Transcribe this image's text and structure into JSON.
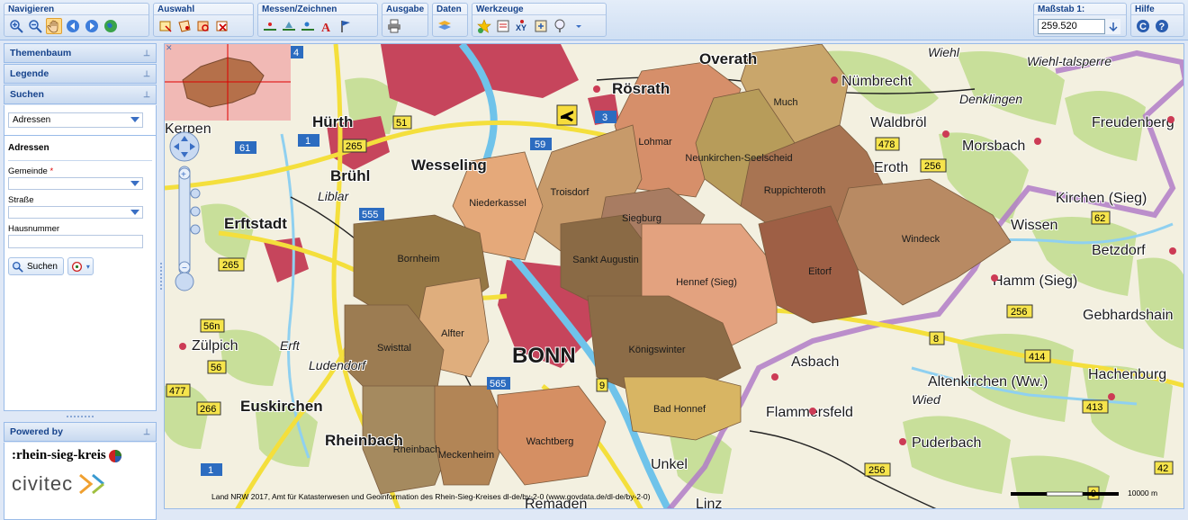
{
  "toolbar": {
    "groups": [
      {
        "title": "Navigieren",
        "icons": [
          "zoom-in-icon",
          "zoom-out-icon",
          "pan-hand-icon",
          "back-arrow-icon",
          "forward-arrow-icon",
          "globe-icon"
        ]
      },
      {
        "title": "Auswahl",
        "icons": [
          "select-rectangle-icon",
          "select-polygon-icon",
          "select-clear-icon",
          "select-delete-icon"
        ]
      },
      {
        "title": "Messen/Zeichnen",
        "icons": [
          "measure-line-icon",
          "measure-area-icon",
          "measure-point-icon",
          "text-draw-icon",
          "flag-icon"
        ]
      },
      {
        "title": "Ausgabe",
        "icons": [
          "print-icon"
        ]
      },
      {
        "title": "Daten",
        "icons": [
          "layers-data-icon"
        ]
      },
      {
        "title": "Werkzeuge",
        "icons": [
          "favorite-star-icon",
          "feature-info-icon",
          "coordinates-xy-icon",
          "export-icon",
          "marker-icon",
          "dropdown-arrow-icon"
        ]
      }
    ],
    "scale": {
      "title": "Maßstab 1:",
      "value": "259.520"
    },
    "help": {
      "title": "Hilfe",
      "icons": [
        "reset-c-icon",
        "help-question-icon"
      ]
    }
  },
  "left_panel": {
    "themenbaum": "Themenbaum",
    "legende": "Legende",
    "suchen": "Suchen",
    "search_type": "Adressen",
    "form_title": "Adressen",
    "fields": {
      "gemeinde": "Gemeinde",
      "strasse": "Straße",
      "hausnummer": "Hausnummer"
    },
    "required_mark": "*",
    "search_button": "Suchen",
    "powered_by": "Powered by",
    "logo1": ":rhein-sieg-kreis",
    "logo2": "civitec"
  },
  "map": {
    "municipalities": [
      {
        "name": "Much",
        "color": "#c9a66b"
      },
      {
        "name": "Lohmar",
        "color": "#d68f6a"
      },
      {
        "name": "Neunkirchen-Seelscheid",
        "color": "#b79c5a"
      },
      {
        "name": "Ruppichteroth",
        "color": "#a87452"
      },
      {
        "name": "Troisdorf",
        "color": "#c79a6a"
      },
      {
        "name": "Niederkassel",
        "color": "#e5a97a"
      },
      {
        "name": "Siegburg",
        "color": "#a87c62"
      },
      {
        "name": "Windeck",
        "color": "#b88a63"
      },
      {
        "name": "Bornheim",
        "color": "#957745"
      },
      {
        "name": "Sankt Augustin",
        "color": "#8a6a45"
      },
      {
        "name": "Hennef (Sieg)",
        "color": "#e3a27f"
      },
      {
        "name": "Eitorf",
        "color": "#9e5f45"
      },
      {
        "name": "Alfter",
        "color": "#dfae7d"
      },
      {
        "name": "Swisttal",
        "color": "#9c7c52"
      },
      {
        "name": "Königswinter",
        "color": "#8c6c47"
      },
      {
        "name": "Bad Honnef",
        "color": "#d8b563"
      },
      {
        "name": "Rheinbach",
        "color": "#a58a5f"
      },
      {
        "name": "Meckenheim",
        "color": "#b28556"
      },
      {
        "name": "Wachtberg",
        "color": "#d58f63"
      }
    ],
    "places": [
      "Overath",
      "Rösrath",
      "Nümbrecht",
      "Wiehl",
      "Wiehl-talsperre",
      "Denklingen",
      "Waldbröl",
      "Freudenberg",
      "Morsbach",
      "Hürth",
      "Kerpen",
      "Brühl",
      "Liblar",
      "Wesseling",
      "Erftstadt",
      "Kirchen (Sieg)",
      "Wissen",
      "Betzdorf",
      "Hamm (Sieg)",
      "Gebhardshain",
      "Zülpich",
      "Ludendorf",
      "BONN",
      "Asbach",
      "Altenkirchen (Ww.)",
      "Hachenburg",
      "Euskirchen",
      "Flammersfeld",
      "Rheinbach",
      "Puderbach",
      "Remagen",
      "Unkel",
      "Linz",
      "Erft",
      "Wied",
      "Eroth"
    ],
    "roads": [
      "4",
      "3",
      "1",
      "51",
      "265",
      "59",
      "61",
      "555",
      "265",
      "478",
      "256",
      "62",
      "8",
      "256",
      "414",
      "413",
      "56n",
      "56",
      "477",
      "266",
      "565",
      "9",
      "1",
      "256",
      "42",
      "9"
    ],
    "copyright": "Land NRW 2017, Amt für Katasterwesen und Geoinformation des Rhein-Sieg-Kreises dl-de/by-2-0 (www.govdata.de/dl-de/by-2-0)",
    "scalebar_label": "10000 m"
  }
}
